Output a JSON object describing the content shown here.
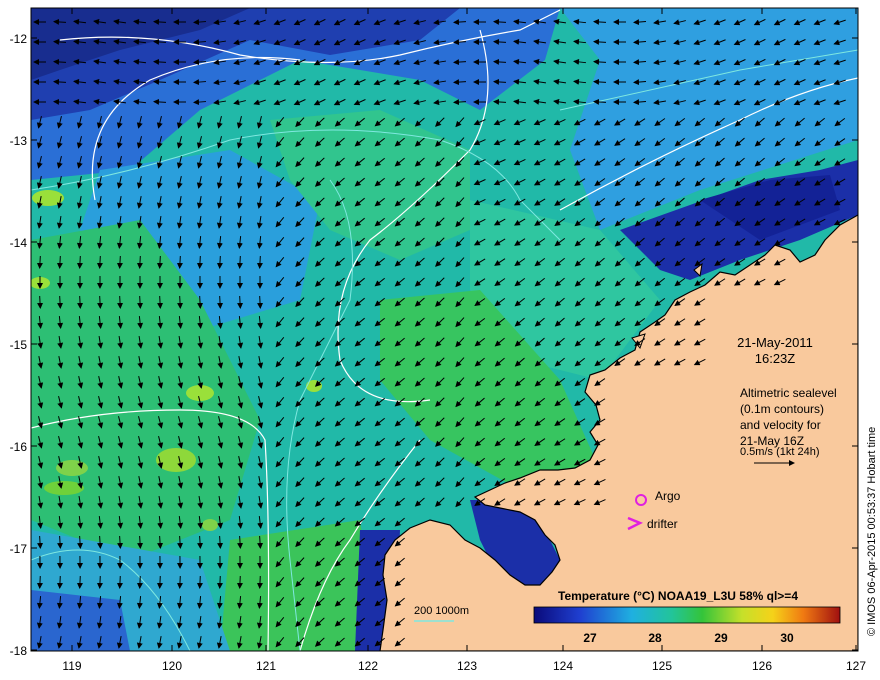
{
  "map": {
    "date": "21-May-2011",
    "time": "16:23Z",
    "info_lines": [
      "Altimetric sealevel",
      "(0.1m contours)",
      "and velocity for",
      "21-May 16Z",
      "0.5m/s (1kt 24h)"
    ],
    "credit": "© IMOS 06-Apr-2015 00:53:37 Hobart time",
    "colorbar_title": "Temperature (°C) NOAA19_L3U 58% ql>=4",
    "colorbar_ticks": [
      "27",
      "28",
      "29",
      "30"
    ],
    "legend_argo": "Argo",
    "legend_drifter": "drifter",
    "isobath_label": "200  1000m",
    "x_ticks": [
      "119",
      "120",
      "121",
      "122",
      "123",
      "124",
      "125",
      "126",
      "127"
    ],
    "y_ticks": [
      "-12",
      "-13",
      "-14",
      "-15",
      "-16",
      "-17",
      "-18"
    ],
    "land_color": "#f9c99d",
    "sea_colors": [
      "#1a2f9c",
      "#1f66d8",
      "#1fa6d4",
      "#22c49a",
      "#2fbf5a",
      "#6fd13a"
    ]
  }
}
